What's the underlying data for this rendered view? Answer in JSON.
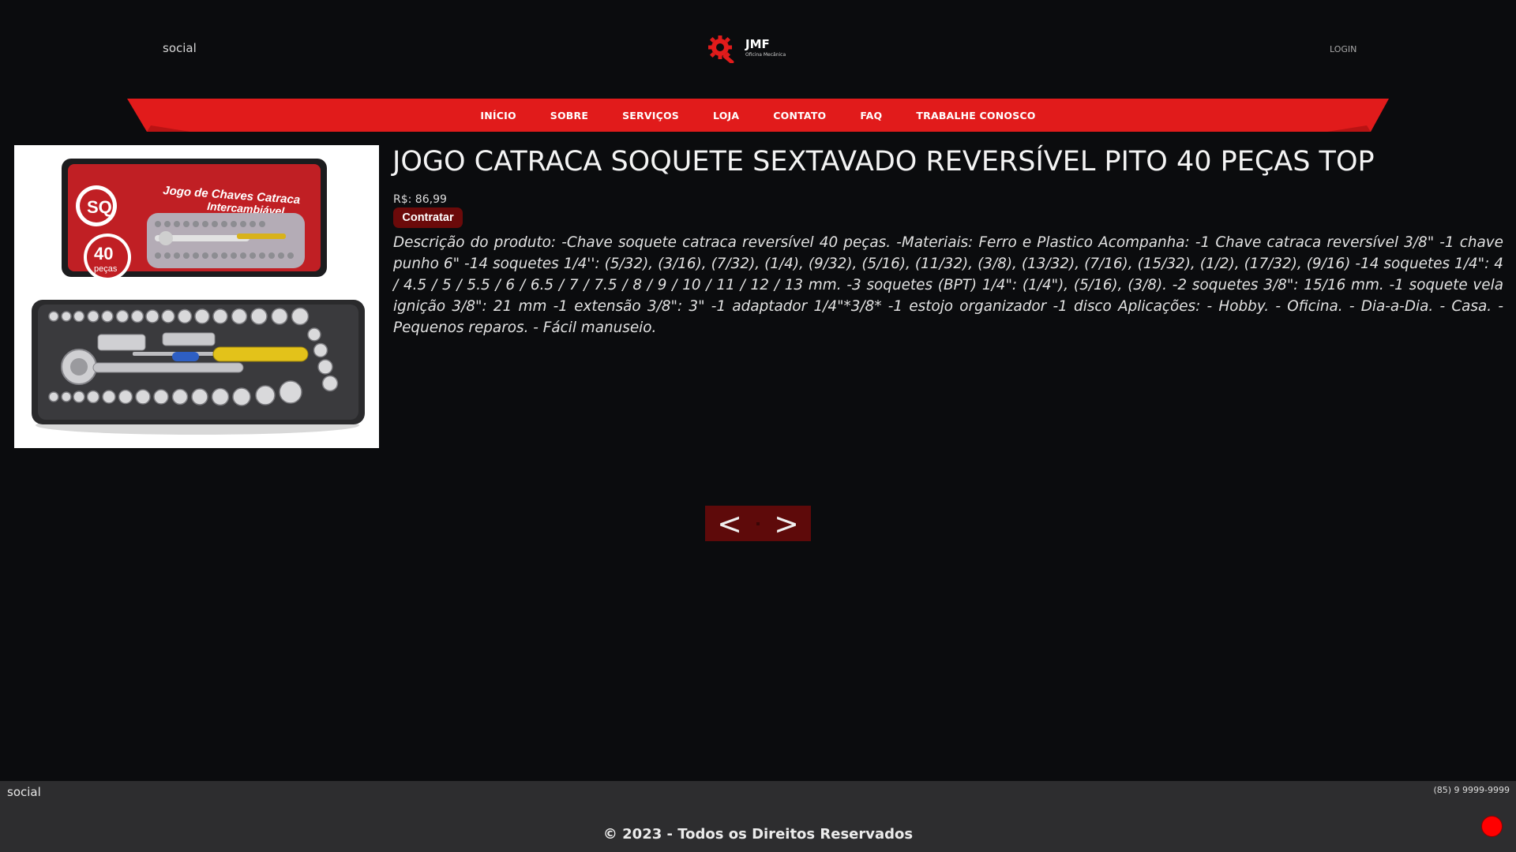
{
  "header": {
    "social_label": "social",
    "logo": {
      "title": "JMF",
      "subtitle": "Oficina Mecânica"
    },
    "login_label": "LOGIN"
  },
  "nav": {
    "items": [
      {
        "label": "INÍCIO"
      },
      {
        "label": "SOBRE"
      },
      {
        "label": "SERVIÇOS"
      },
      {
        "label": "LOJA"
      },
      {
        "label": "CONTATO"
      },
      {
        "label": "FAQ"
      },
      {
        "label": "TRABALHE CONOSCO"
      }
    ],
    "color": "#e11b1b"
  },
  "product": {
    "title": "JOGO CATRACA SOQUETE SEXTAVADO REVERSÍVEL PITO 40 PEÇAS TOP",
    "price": "R$: 86,99",
    "hire_label": "Contratar",
    "description": "Descrição do produto: -Chave soquete catraca reversível 40 peças. -Materiais: Ferro e Plastico Acompanha: -1 Chave catraca reversível 3/8\" -1 chave punho 6\" -14 soquetes 1/4'': (5/32), (3/16), (7/32), (1/4), (9/32), (5/16), (11/32), (3/8), (13/32), (7/16), (15/32), (1/2), (17/32), (9/16) -14 soquetes 1/4\": 4 / 4.5 / 5 / 5.5 / 6 / 6.5 / 7 / 7.5 / 8 / 9 / 10 / 11 / 12 / 13 mm. -3 soquetes (BPT) 1/4\": (1/4\"), (5/16), (3/8). -2 soquetes 3/8\": 15/16 mm. -1 soquete vela ignição 3/8\": 21 mm -1 extensão 3/8\": 3\" -1 adaptador 1/4\"*3/8* -1 estojo organizador -1 disco Aplicações: - Hobby. - Oficina. - Dia-a-Dia. - Casa. - Pequenos reparos. - Fácil manuseio.",
    "image": {
      "box_text_line1": "Jogo de Chaves Catraca",
      "box_text_line2": "Intercambiável",
      "brand": "SQ",
      "badge_number": "40",
      "badge_label": "peças"
    }
  },
  "pager": {
    "prev_label": "<",
    "next_label": ">"
  },
  "footer": {
    "social_label": "social",
    "phone": "(85) 9 9999-9999",
    "copyright": "© 2023 - Todos os Direitos Reservados"
  },
  "colors": {
    "background": "#0b0c0e",
    "accent": "#e11b1b",
    "footer": "#2d2d2f",
    "button": "#6b0a0a"
  }
}
